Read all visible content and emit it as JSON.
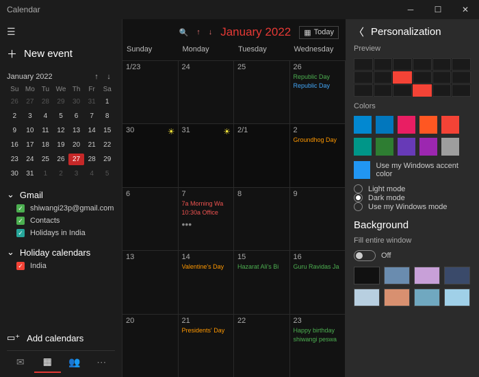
{
  "titlebar": {
    "title": "Calendar"
  },
  "sidebar": {
    "new_event": "New event",
    "mini_month": "January 2022",
    "dow": [
      "Su",
      "Mo",
      "Tu",
      "We",
      "Th",
      "Fr",
      "Sa"
    ],
    "weeks": [
      [
        {
          "d": "26",
          "o": true
        },
        {
          "d": "27",
          "o": true
        },
        {
          "d": "28",
          "o": true
        },
        {
          "d": "29",
          "o": true
        },
        {
          "d": "30",
          "o": true
        },
        {
          "d": "31",
          "o": true
        },
        {
          "d": "1"
        }
      ],
      [
        {
          "d": "2"
        },
        {
          "d": "3"
        },
        {
          "d": "4"
        },
        {
          "d": "5"
        },
        {
          "d": "6"
        },
        {
          "d": "7"
        },
        {
          "d": "8"
        }
      ],
      [
        {
          "d": "9"
        },
        {
          "d": "10"
        },
        {
          "d": "11"
        },
        {
          "d": "12"
        },
        {
          "d": "13"
        },
        {
          "d": "14"
        },
        {
          "d": "15"
        }
      ],
      [
        {
          "d": "16"
        },
        {
          "d": "17"
        },
        {
          "d": "18"
        },
        {
          "d": "19"
        },
        {
          "d": "20"
        },
        {
          "d": "21"
        },
        {
          "d": "22"
        }
      ],
      [
        {
          "d": "23"
        },
        {
          "d": "24"
        },
        {
          "d": "25"
        },
        {
          "d": "26"
        },
        {
          "d": "27",
          "t": true
        },
        {
          "d": "28"
        },
        {
          "d": "29"
        }
      ],
      [
        {
          "d": "30"
        },
        {
          "d": "31"
        },
        {
          "d": "1",
          "o": true
        },
        {
          "d": "2",
          "o": true
        },
        {
          "d": "3",
          "o": true
        },
        {
          "d": "4",
          "o": true
        },
        {
          "d": "5",
          "o": true
        }
      ]
    ],
    "accounts": [
      {
        "name": "Gmail",
        "calendars": [
          {
            "color": "green",
            "label": "shiwangi23p@gmail.com"
          },
          {
            "color": "green",
            "label": "Contacts"
          },
          {
            "color": "teal",
            "label": "Holidays in India"
          }
        ]
      },
      {
        "name": "Holiday calendars",
        "calendars": [
          {
            "color": "red",
            "label": "India"
          }
        ]
      }
    ],
    "add_calendars": "Add calendars"
  },
  "toolbar": {
    "month": "January 2022",
    "today": "Today"
  },
  "dow": [
    "Sunday",
    "Monday",
    "Tuesday",
    "Wednesday"
  ],
  "grid": [
    [
      {
        "date": "1/23"
      },
      {
        "date": "24"
      },
      {
        "date": "25"
      },
      {
        "date": "26",
        "events": [
          {
            "c": "green",
            "t": "Republic Day"
          },
          {
            "c": "blue",
            "t": "Republic Day"
          }
        ]
      }
    ],
    [
      {
        "date": "30",
        "sun": true,
        "off": true
      },
      {
        "date": "31",
        "sun": true,
        "off": true
      },
      {
        "date": "2/1",
        "off": true
      },
      {
        "date": "2",
        "off": true,
        "events": [
          {
            "c": "orange",
            "t": "Groundhog Day"
          }
        ]
      }
    ],
    [
      {
        "date": "6"
      },
      {
        "date": "7",
        "events": [
          {
            "c": "red",
            "t": "7a Morning Wa"
          },
          {
            "c": "red",
            "t": "10:30a Office"
          }
        ],
        "more": true
      },
      {
        "date": "8"
      },
      {
        "date": "9"
      }
    ],
    [
      {
        "date": "13"
      },
      {
        "date": "14",
        "events": [
          {
            "c": "orange",
            "t": "Valentine's Day"
          }
        ]
      },
      {
        "date": "15",
        "events": [
          {
            "c": "green",
            "t": "Hazarat Ali's Bi"
          }
        ]
      },
      {
        "date": "16",
        "events": [
          {
            "c": "green",
            "t": "Guru Ravidas Ja"
          }
        ]
      }
    ],
    [
      {
        "date": "20"
      },
      {
        "date": "21",
        "events": [
          {
            "c": "orange",
            "t": "Presidents' Day"
          }
        ]
      },
      {
        "date": "22"
      },
      {
        "date": "23",
        "events": [
          {
            "c": "green",
            "t": "Happy birthday"
          },
          {
            "c": "green",
            "t": "shiwangi peswa"
          }
        ]
      }
    ]
  ],
  "panel": {
    "title": "Personalization",
    "preview": "Preview",
    "colors_label": "Colors",
    "colors": [
      "#0288d1",
      "#0277bd",
      "#e91e63",
      "#ff5722",
      "#f44336",
      "#009688",
      "#2e7d32",
      "#673ab7",
      "#9c27b0",
      "#9e9e9e"
    ],
    "accent": {
      "color": "#2196f3",
      "label": "Use my Windows accent color"
    },
    "modes": [
      {
        "label": "Light mode",
        "on": false
      },
      {
        "label": "Dark mode",
        "on": true
      },
      {
        "label": "Use my Windows mode",
        "on": false
      }
    ],
    "bg_title": "Background",
    "fill_label": "Fill entire window",
    "toggle_state": "Off",
    "thumbs": [
      "#111111",
      "#6a8caf",
      "#c8a0d8",
      "#3a4a6a",
      "#b8cfe0",
      "#d89070",
      "#70a8c0",
      "#a0d0e8"
    ]
  }
}
